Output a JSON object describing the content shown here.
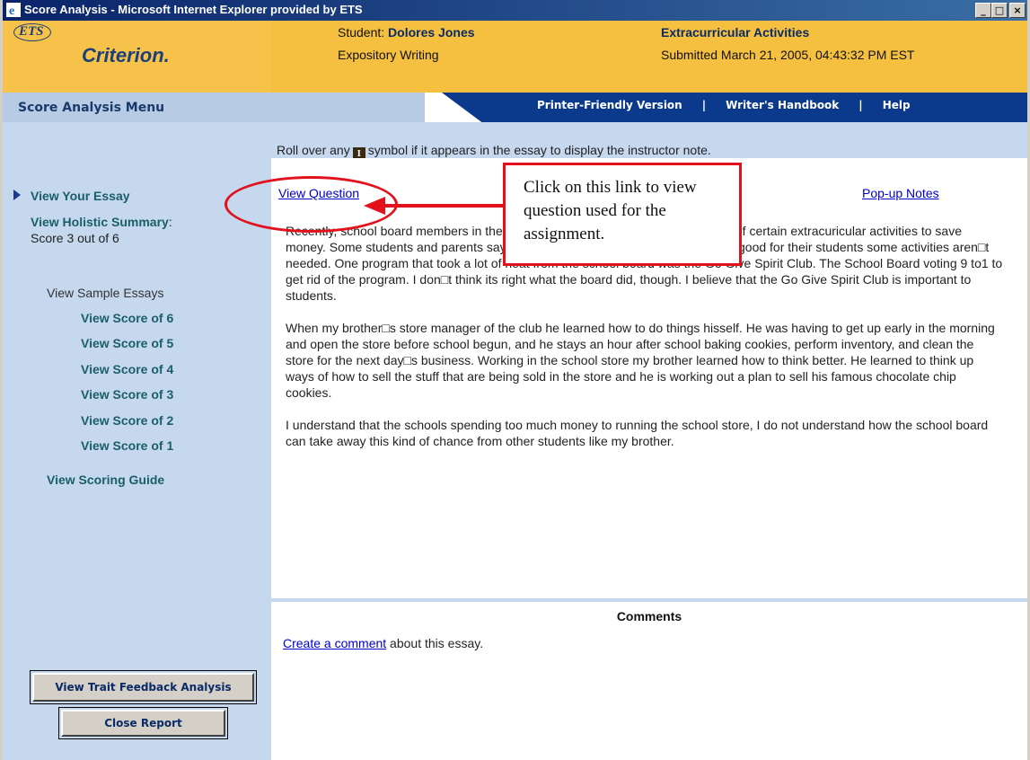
{
  "window": {
    "title": "Score Analysis - Microsoft Internet Explorer provided by ETS",
    "min": "_",
    "max": "□",
    "close": "×"
  },
  "header": {
    "logo_ets": "ETS",
    "logo_criterion": "Criterion.",
    "student_label": "Student:",
    "student_name": "Dolores Jones",
    "essay_type": "Expository Writing",
    "assignment_title": "Extracurricular Activities",
    "submitted": "Submitted March 21, 2005, 04:43:32 PM EST"
  },
  "menu": {
    "label": "Score Analysis Menu",
    "links": [
      "Printer-Friendly Version",
      "Writer's Handbook",
      "Help"
    ],
    "separator": "|"
  },
  "instruction": {
    "before": "Roll over any",
    "symbol": "I",
    "after": "symbol if it appears in the essay to display the instructor note."
  },
  "sidebar": {
    "view_your_essay": "View Your Essay",
    "holistic_summary": "View Holistic Summary",
    "colon": ":",
    "score": "Score 3 out of 6",
    "sample_essays_label": "View Sample Essays",
    "scores": [
      "View Score of 6",
      "View Score of 5",
      "View Score of 4",
      "View Score of 3",
      "View Score of 2",
      "View Score of 1"
    ],
    "scoring_guide": "View Scoring Guide",
    "trait_button": "View Trait Feedback Analysis",
    "close_button": "Close Report"
  },
  "main": {
    "view_question": "View Question",
    "popup_notes": "Pop-up Notes",
    "essay_paragraphs": [
      "Recently, school board members in the Springfield school district voted to get rid of certain extracuricular activities to save money. Some students and parents say that although extracuricular activities are good for their students some activities aren□t needed. One program that took a lot of heat from the school board was the Go Give Spirit Club. The School Board voting 9 to1 to get rid of the program. I don□t think its right what the board did, though. I believe that the Go Give Spirit Club is important to students.",
      "When my brother□s store manager of the club he learned how to do things hisself. He was having to get up early in the morning and open the store before school begun, and he stays an hour after school baking cookies, perform inventory, and clean the store for the next day□s business. Working in the school store my brother learned how to think better. He learned to think up ways of how to sell the stuff that are being sold in the store and he is working out a plan to sell his famous chocolate chip cookies.",
      "I understand that the schools spending too much money to running the school store, I do not understand how the school board can take away this kind of chance from other students like my brother."
    ],
    "comments_heading": "Comments",
    "create_comment_link": "Create a comment",
    "create_comment_rest": " about this essay."
  },
  "callout": {
    "text": "Click on this link to view question used for the assignment."
  },
  "colors": {
    "header_gold": "#f5c040",
    "nav_blue": "#0b3a8c",
    "sidebar_blue": "#c6d8ee",
    "annotation_red": "#e3111b",
    "link_blue": "#0000cc"
  }
}
